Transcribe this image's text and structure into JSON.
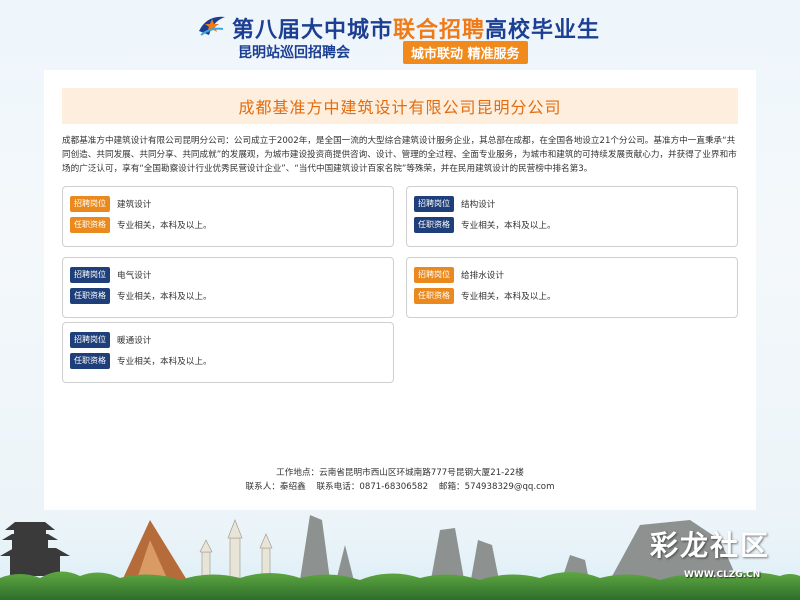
{
  "header": {
    "title_prefix": "第八届大中城市",
    "title_accent": "联合招聘",
    "title_suffix": "高校毕业生",
    "subtitle": "昆明站巡回招聘会",
    "badge": "城市联动 精准服务"
  },
  "company": {
    "name": "成都基准方中建筑设计有限公司昆明分公司",
    "intro": "成都基准方中建筑设计有限公司昆明分公司：公司成立于2002年，是全国一流的大型综合建筑设计服务企业，其总部在成都，在全国各地设立21个分公司。基准方中一直秉承“共同创造、共同发展、共同分享、共同成就”的发展观，为城市建设投资商提供咨询、设计、管理的全过程、全面专业服务，为城市和建筑的可持续发展贡献心力，并获得了业界和市场的广泛认可，享有“全国勘察设计行业优秀民营设计企业”、“当代中国建筑设计百家名院”等殊荣，并在民用建筑设计的民营榜中排名第3。"
  },
  "labels": {
    "position": "招聘岗位",
    "qualification": "任职资格"
  },
  "jobs": [
    {
      "title": "建筑设计",
      "requirement": "专业相关，本科及以上。"
    },
    {
      "title": "结构设计",
      "requirement": "专业相关，本科及以上。"
    },
    {
      "title": "电气设计",
      "requirement": "专业相关，本科及以上。"
    },
    {
      "title": "给排水设计",
      "requirement": "专业相关，本科及以上。"
    },
    {
      "title": "暖通设计",
      "requirement": "专业相关，本科及以上。"
    }
  ],
  "footer": {
    "address": "工作地点：云南省昆明市西山区环城南路777号昆钢大厦21-22楼",
    "contact": "联系人：秦绍鑫",
    "phone": "联系电话：0871-68306582",
    "email": "邮箱：574938329@qq.com"
  },
  "watermark": {
    "text": "彩龙社区",
    "url": "WWW.CLZG.CN"
  },
  "colors": {
    "brand_blue": "#1c3f93",
    "accent_orange": "#f07a17",
    "tag_navy": "#1f3f7a",
    "tag_orange": "#ea8a1e"
  }
}
